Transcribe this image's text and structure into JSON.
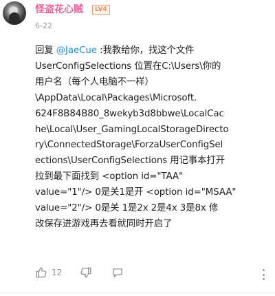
{
  "comment": {
    "username": "怪盗花心贼",
    "level_badge": "LV4",
    "date": "6-22",
    "body": {
      "reply_prefix": "回复 ",
      "mention": "@JaeCue",
      "lines": [
        " :我教给你，找这个文件",
        "UserConfigSelections 位置在C:\\Users\\你的",
        "用户名（每个人电脑不一样）",
        "\\AppData\\Local\\Packages\\Microsoft.",
        "624F8B84B80_8wekyb3d8bbwe\\LocalCac",
        "he\\Local\\User_GamingLocalStorageDirecto",
        "ry\\ConnectedStorage\\ForzaUserConfigSel",
        "ections\\UserConfigSelections 用记事本打开",
        "拉到最下面找到 <option id=\"TAA\"",
        "value=\"1\"/> 0是关1是开 <option id=\"MSAA\"",
        "value=\"2\"/> 0是关  1是2x  2是4x 3是8x   修",
        "改保存进游戏再去看就同时开启了"
      ]
    },
    "actions": {
      "like_icon": "thumbs-up-icon",
      "like_count": "12",
      "dislike_icon": "thumbs-down-icon",
      "reply_icon": "comment-icon",
      "more_icon": "more-vertical-icon"
    }
  },
  "colors": {
    "username": "#f0609a",
    "mention": "#1b8fd6",
    "badge": "#ef8a50",
    "muted": "#9a9a9a"
  }
}
